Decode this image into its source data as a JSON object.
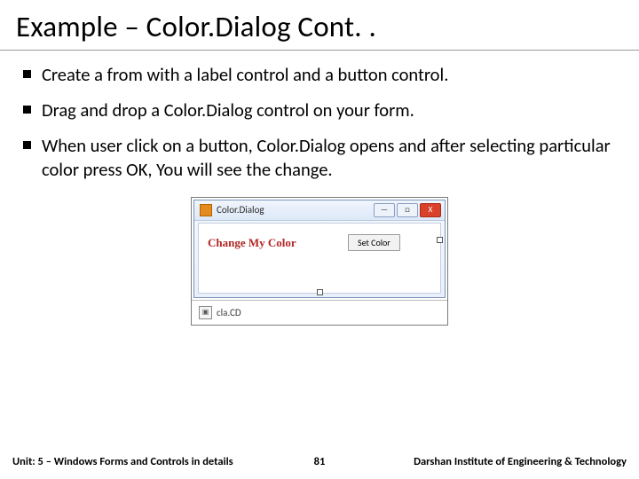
{
  "title": "Example – Color.Dialog Cont. .",
  "bullets": [
    "Create a from with a label control and a button control.",
    "Drag and drop a Color.Dialog control on your form.",
    "When user click on a button, Color.Dialog opens and after selecting particular color press OK, You will see the change."
  ],
  "winform": {
    "title": "Color.Dialog",
    "minimize": "—",
    "maximize": "□",
    "close": "X",
    "label_text": "Change My Color",
    "button_text": "Set Color"
  },
  "tray": {
    "icon_glyph": "▣",
    "label": "cla.CD"
  },
  "footer": {
    "left": "Unit: 5 – Windows Forms and Controls in details",
    "page": "81",
    "right": "Darshan Institute of Engineering & Technology"
  }
}
